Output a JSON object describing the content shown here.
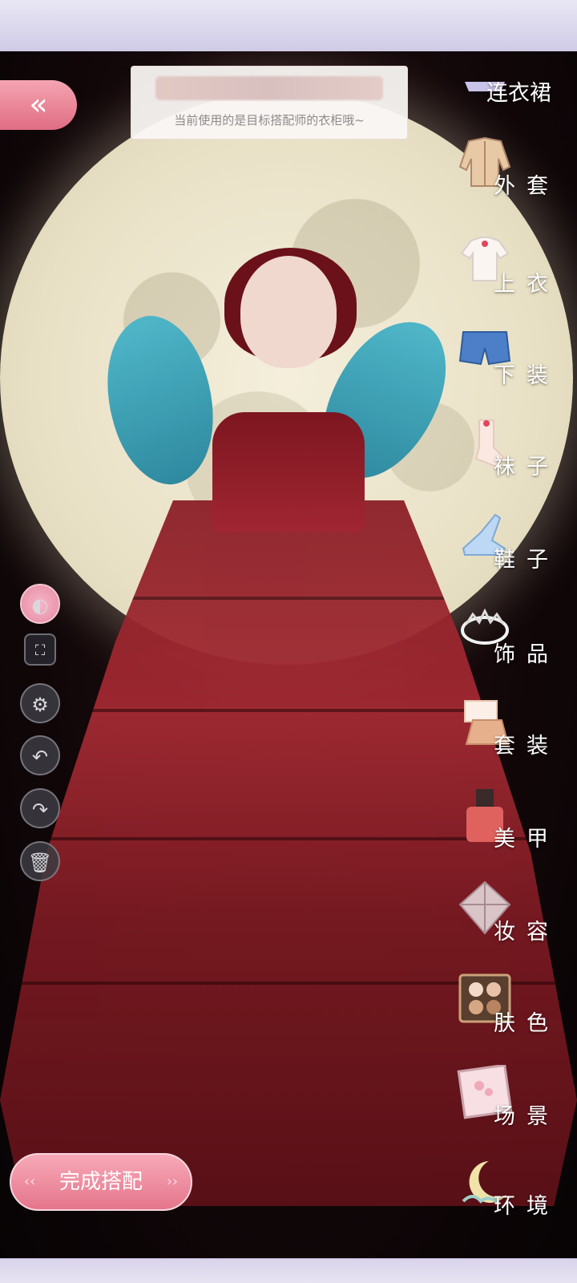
{
  "notice": {
    "text": "当前使用的是目标搭配师的衣柜哦~"
  },
  "back_button": {
    "icon": "double-chevron-left-icon",
    "glyph": "«"
  },
  "tools": [
    {
      "name": "palette-icon",
      "glyph": "◐"
    },
    {
      "name": "fullscreen-icon",
      "glyph": "⛶"
    },
    {
      "name": "gear-icon",
      "glyph": "⚙"
    },
    {
      "name": "undo-icon",
      "glyph": "↶"
    },
    {
      "name": "redo-icon",
      "glyph": "↷"
    },
    {
      "name": "trash-icon",
      "glyph": "🗑"
    }
  ],
  "finish_button": {
    "label": "完成搭配"
  },
  "categories": [
    {
      "key": "dress",
      "label": "连衣裙",
      "icon": "dress-icon"
    },
    {
      "key": "coat",
      "label": "外套",
      "icon": "coat-icon"
    },
    {
      "key": "top",
      "label": "上衣",
      "icon": "shirt-icon"
    },
    {
      "key": "bottom",
      "label": "下装",
      "icon": "shorts-icon"
    },
    {
      "key": "socks",
      "label": "袜子",
      "icon": "sock-icon"
    },
    {
      "key": "shoes",
      "label": "鞋子",
      "icon": "shoe-icon"
    },
    {
      "key": "accessory",
      "label": "饰品",
      "icon": "tiara-icon"
    },
    {
      "key": "suit",
      "label": "套装",
      "icon": "outfit-icon"
    },
    {
      "key": "nails",
      "label": "美甲",
      "icon": "nail-polish-icon"
    },
    {
      "key": "makeup",
      "label": "妆容",
      "icon": "makeup-icon"
    },
    {
      "key": "skin",
      "label": "肤色",
      "icon": "skin-palette-icon"
    },
    {
      "key": "scene",
      "label": "场景",
      "icon": "scene-icon"
    },
    {
      "key": "environment",
      "label": "环境",
      "icon": "moon-icon"
    }
  ],
  "colors": {
    "accent_pink": "#e5758b",
    "gown_red": "#8c1f28",
    "moon": "#f4efdc"
  }
}
